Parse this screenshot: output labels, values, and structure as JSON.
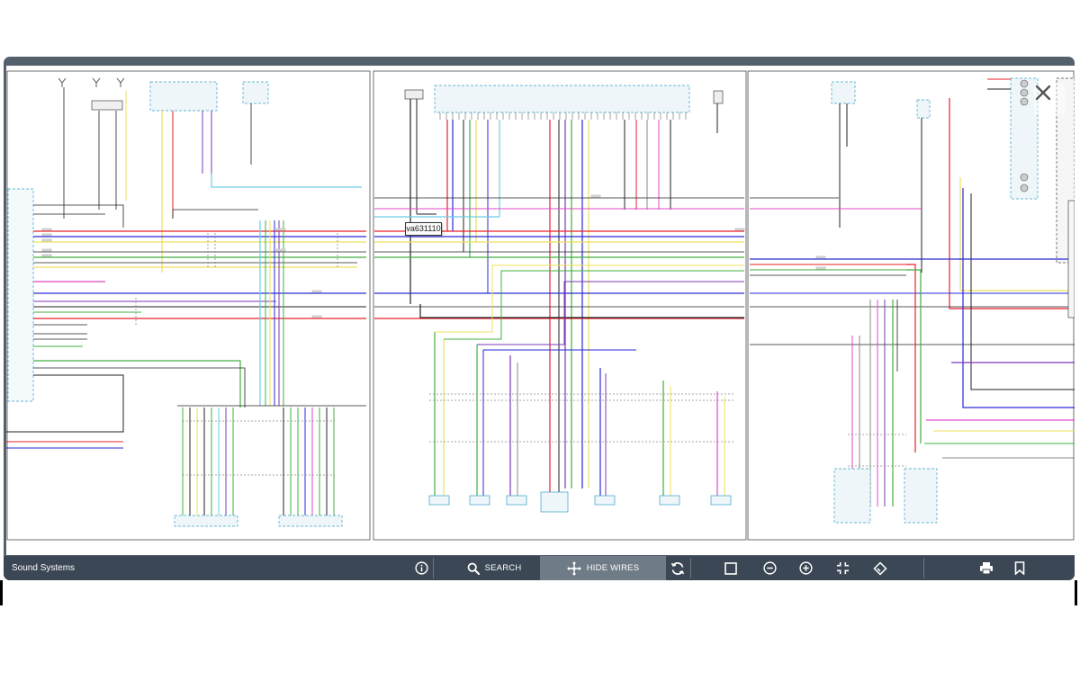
{
  "viewer": {
    "title": "Sound Systems",
    "callout_text": "va631110",
    "close_icon": "close-icon"
  },
  "toolbar": {
    "info_icon": "info-icon",
    "search_label": "SEARCH",
    "search_icon": "search-icon",
    "hide_wires_label": "HIDE WIRES",
    "hide_wires_icon": "hide-wires-icon",
    "rotate_icon": "rotate-icon",
    "fit_icon": "fit-page-icon",
    "zoom_out_icon": "zoom-out-icon",
    "zoom_in_icon": "zoom-in-icon",
    "fullscreen_icon": "fullscreen-icon",
    "erase_icon": "erase-icon",
    "print_icon": "print-icon",
    "bookmark_icon": "bookmark-icon"
  },
  "colors": {
    "frame": "#54606c",
    "toolbar": "#3b4754",
    "toolbar_active": "#6f7b87",
    "wire_red": "#e8212a",
    "wire_green": "#40b040",
    "wire_yellow": "#ece05a",
    "wire_blue": "#2a2ad8",
    "wire_violet": "#7a3ab8",
    "wire_lightblue": "#6ccce8",
    "wire_pink": "#e048c8",
    "wire_orange": "#e87a2a",
    "wire_black": "#222222",
    "wire_gray": "#8a8a8a"
  }
}
